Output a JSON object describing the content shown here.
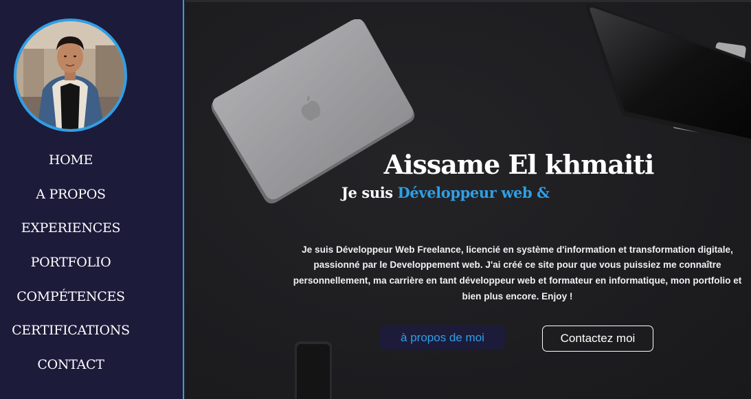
{
  "profile": {
    "photo_icon": "profile-photo"
  },
  "nav": {
    "items": [
      {
        "label": "HOME"
      },
      {
        "label": "A PROPOS"
      },
      {
        "label": "EXPERIENCES"
      },
      {
        "label": "PORTFOLIO"
      },
      {
        "label": "COMPÉTENCES"
      },
      {
        "label": "CERTIFICATIONS"
      },
      {
        "label": "CONTACT"
      }
    ]
  },
  "hero": {
    "name": "Aissame El khmaiti",
    "tagline_lead": "Je suis",
    "tagline_role": "Développeur web &",
    "bio": "Je suis Développeur Web Freelance, licencié en système d'information et transformation digitale, passionné par le Developpement web. J'ai créé ce site pour que vous puissiez me connaître personnellement, ma carrière en tant développeur web et formateur en informatique, mon portfolio et bien plus encore. Enjoy !",
    "about_button": "à propos de moi",
    "contact_button": "Contactez moi"
  },
  "colors": {
    "accent": "#2f9fe6",
    "sidebar_bg": "#1c1b3a",
    "hero_bg": "#1f1f22"
  },
  "decor": {
    "laptop_icon": "laptop-icon",
    "monitor_icon": "monitor-icon",
    "phone_icon": "phone-icon"
  }
}
